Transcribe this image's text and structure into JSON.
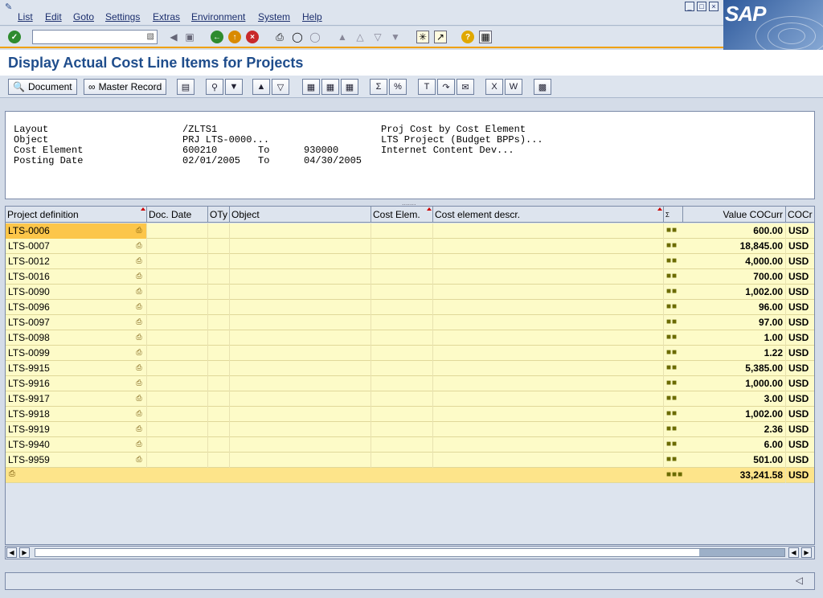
{
  "menu": {
    "items": [
      "List",
      "Edit",
      "Goto",
      "Settings",
      "Extras",
      "Environment",
      "System",
      "Help"
    ]
  },
  "brand": {
    "logo_text": "SAP"
  },
  "toolbar": {
    "command_value": ""
  },
  "page": {
    "title": "Display Actual Cost Line Items for Projects"
  },
  "app_toolbar": {
    "document_label": "Document",
    "master_record_label": "Master Record"
  },
  "header": {
    "layout_label": "Layout",
    "layout_value": "/ZLTS1",
    "layout_desc": "Proj Cost by Cost Element",
    "object_label": "Object",
    "object_value": "PRJ LTS-0000...",
    "object_desc": "LTS Project (Budget BPPs)...",
    "cost_element_label": "Cost Element",
    "cost_element_from": "600210",
    "cost_element_to_label": "To",
    "cost_element_to": "930000",
    "cost_element_desc": "Internet Content Dev...",
    "posting_date_label": "Posting Date",
    "posting_date_from": "02/01/2005",
    "posting_date_to_label": "To",
    "posting_date_to": "04/30/2005"
  },
  "grid": {
    "columns": [
      "Project definition",
      "Doc. Date",
      "OTy",
      "Object",
      "Cost Elem.",
      "Cost element descr.",
      "Σ",
      "Value COCurr",
      "COCr"
    ],
    "rows": [
      {
        "project": "LTS-0006",
        "value": "600.00",
        "currency": "USD"
      },
      {
        "project": "LTS-0007",
        "value": "18,845.00",
        "currency": "USD"
      },
      {
        "project": "LTS-0012",
        "value": "4,000.00",
        "currency": "USD"
      },
      {
        "project": "LTS-0016",
        "value": "700.00",
        "currency": "USD"
      },
      {
        "project": "LTS-0090",
        "value": "1,002.00",
        "currency": "USD"
      },
      {
        "project": "LTS-0096",
        "value": "96.00",
        "currency": "USD"
      },
      {
        "project": "LTS-0097",
        "value": "97.00",
        "currency": "USD"
      },
      {
        "project": "LTS-0098",
        "value": "1.00",
        "currency": "USD"
      },
      {
        "project": "LTS-0099",
        "value": "1.22",
        "currency": "USD"
      },
      {
        "project": "LTS-9915",
        "value": "5,385.00",
        "currency": "USD"
      },
      {
        "project": "LTS-9916",
        "value": "1,000.00",
        "currency": "USD"
      },
      {
        "project": "LTS-9917",
        "value": "3.00",
        "currency": "USD"
      },
      {
        "project": "LTS-9918",
        "value": "1,002.00",
        "currency": "USD"
      },
      {
        "project": "LTS-9919",
        "value": "2.36",
        "currency": "USD"
      },
      {
        "project": "LTS-9940",
        "value": "6.00",
        "currency": "USD"
      },
      {
        "project": "LTS-9959",
        "value": "501.00",
        "currency": "USD"
      }
    ],
    "total": {
      "value": "33,241.58",
      "currency": "USD"
    }
  },
  "colors": {
    "accent": "#1f4d8c",
    "selection": "#fcc64a",
    "row": "#fdfbc8",
    "total_row": "#fde48a"
  }
}
